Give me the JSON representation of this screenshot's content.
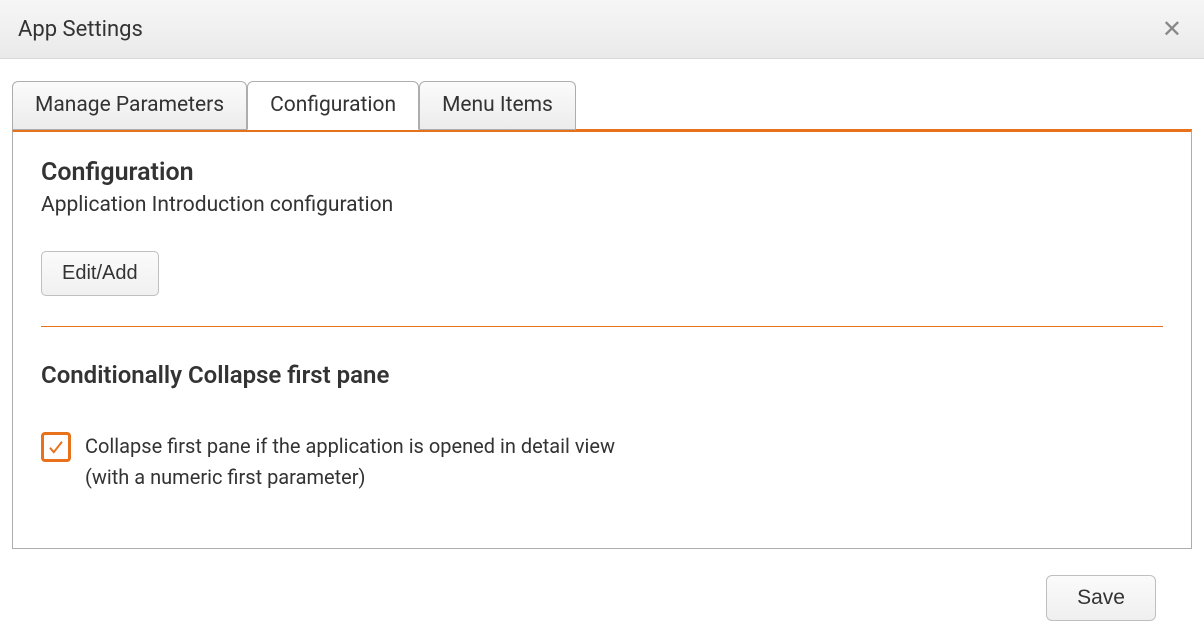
{
  "titlebar": {
    "title": "App Settings"
  },
  "tabs": {
    "manage": "Manage Parameters",
    "config": "Configuration",
    "menu": "Menu Items",
    "active": "config"
  },
  "section1": {
    "title": "Configuration",
    "subtitle": "Application Introduction configuration",
    "button": "Edit/Add"
  },
  "section2": {
    "title": "Conditionally Collapse first pane",
    "checked": true,
    "line1": "Collapse first pane if the application is opened in detail view",
    "line2": "(with a numeric first parameter)"
  },
  "footer": {
    "save": "Save"
  },
  "colors": {
    "accent": "#e8721b"
  }
}
